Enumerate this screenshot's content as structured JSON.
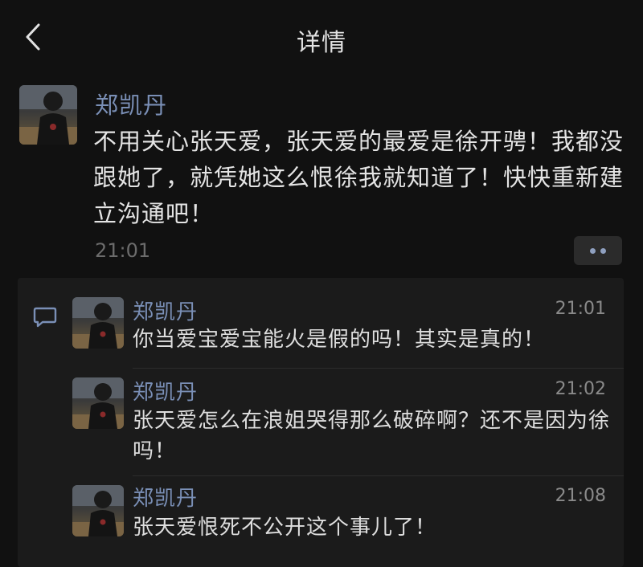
{
  "header": {
    "title": "详情",
    "back_icon": "chevron-left-icon"
  },
  "post": {
    "author": "郑凯丹",
    "content": "不用关心张天爱，张天爱的最爱是徐开骋！我都没跟她了，就凭她这么恨徐我就知道了！快快重新建立沟通吧！",
    "time": "21:01",
    "more_icon": "more-dots-icon"
  },
  "comments": [
    {
      "author": "郑凯丹",
      "time": "21:01",
      "text": "你当爱宝爱宝能火是假的吗！其实是真的！"
    },
    {
      "author": "郑凯丹",
      "time": "21:02",
      "text": "张天爱怎么在浪姐哭得那么破碎啊？还不是因为徐吗！"
    },
    {
      "author": "郑凯丹",
      "time": "21:08",
      "text": "张天爱恨死不公开这个事儿了！"
    }
  ],
  "colors": {
    "background": "#111111",
    "name": "#7a8fb6",
    "text": "#e4e4e4",
    "panel": "#1b1b1b"
  }
}
